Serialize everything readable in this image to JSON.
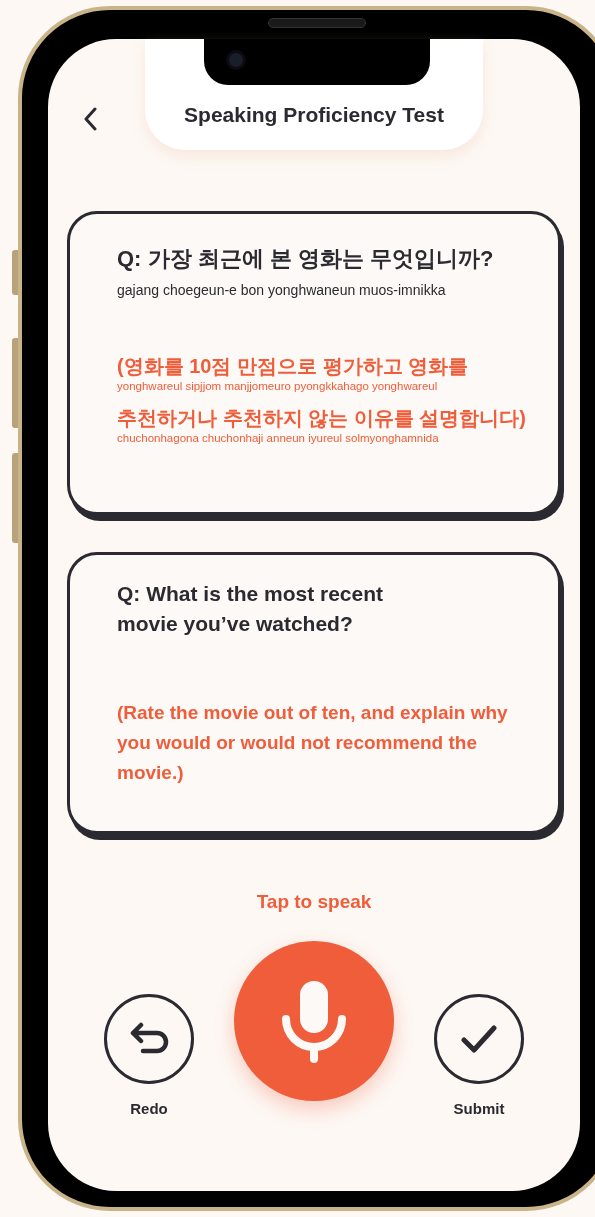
{
  "header": {
    "title": "Speaking Proficiency Test"
  },
  "cards": [
    {
      "kind": "korean",
      "question": "Q: 가장 최근에 본 영화는 무엇입니까?",
      "romanization": "gajang choegeun-e bon yonghwaneun muos-imnikka",
      "instruction_lines": [
        {
          "text": "(영화를 10점 만점으로 평가하고 영화를",
          "romanization": "yonghwareul sipjjom manjjomeuro pyongkkahago yonghwareul"
        },
        {
          "text": "추천하거나 추천하지 않는 이유를 설명합니다)",
          "romanization": "chuchonhagona chuchonhaji anneun iyureul solmyonghamnida"
        }
      ]
    },
    {
      "kind": "english",
      "question": "Q: What is the most recent movie you’ve watched?",
      "instruction": "(Rate the movie out of ten, and explain why you would or would not recommend the movie.)"
    }
  ],
  "prompt": "Tap to speak",
  "actions": [
    {
      "kind": "redo",
      "label": "Redo"
    },
    {
      "kind": "mic"
    },
    {
      "kind": "submit",
      "label": "Submit"
    }
  ]
}
